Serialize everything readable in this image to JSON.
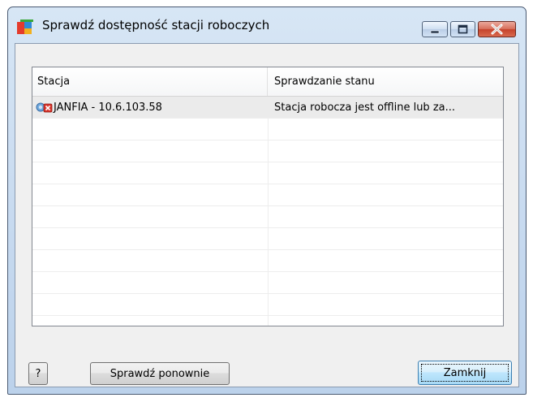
{
  "window": {
    "title": "Sprawdź dostępność stacji roboczych"
  },
  "list": {
    "columns": [
      "Stacja",
      "Sprawdzanie stanu"
    ],
    "rows": [
      {
        "station": "JANFIA - 10.6.103.58",
        "status": "Stacja robocza jest offline lub za...",
        "icon": "workstation-offline-icon"
      }
    ]
  },
  "buttons": {
    "help": "?",
    "recheck": "Sprawdź ponownie",
    "close": "Zamknij"
  },
  "colors": {
    "titlebar": "#c6d9ef",
    "client_bg": "#f0f0f0",
    "selected_row": "#ebebeb",
    "default_button_border": "#3c7fb1"
  }
}
